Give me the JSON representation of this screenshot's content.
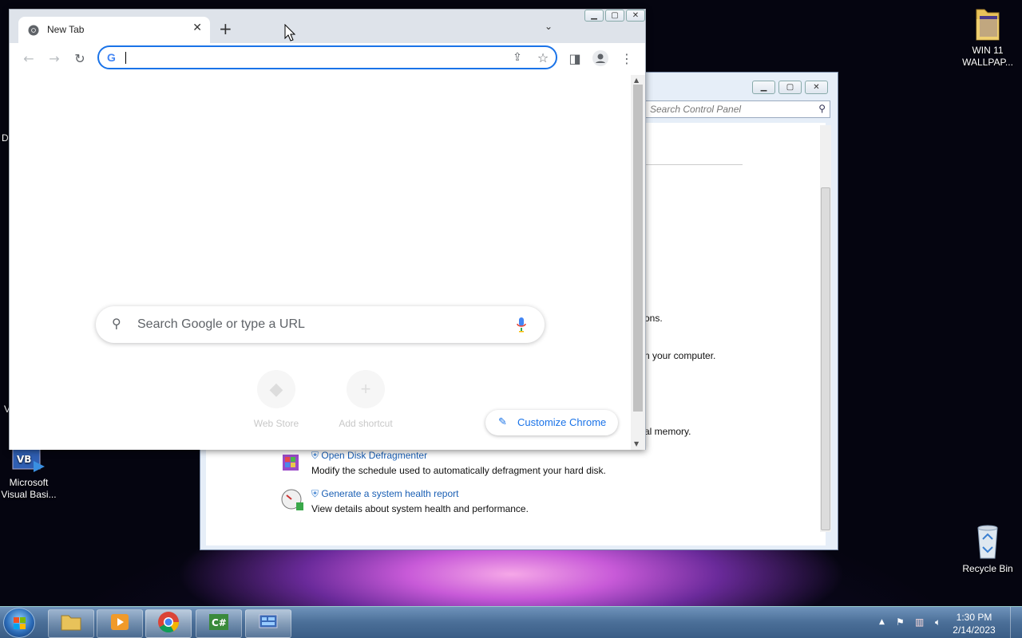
{
  "desktop": {
    "icons": [
      {
        "label": "WIN 11 WALLPAP..."
      },
      {
        "label": "Microsoft Visual Basi..."
      },
      {
        "label": "Recycle Bin"
      }
    ],
    "edge_fragments": [
      "D",
      "V"
    ]
  },
  "control_panel": {
    "search_placeholder": "Search Control Panel",
    "fragments": [
      "ons.",
      "n your computer.",
      "al memory."
    ],
    "items": [
      {
        "link": "Open Disk Defragmenter",
        "desc": "Modify the schedule used to automatically defragment your hard disk."
      },
      {
        "link": "Generate a system health report",
        "desc": "View details about system health and performance."
      }
    ]
  },
  "chrome": {
    "tab_title": "New Tab",
    "omnibox_value": "",
    "search_placeholder": "Search Google or type a URL",
    "shortcuts": [
      {
        "label": "Web Store"
      },
      {
        "label": "Add shortcut"
      }
    ],
    "customize_label": "Customize Chrome"
  },
  "taskbar": {
    "apps": [
      "windows-explorer",
      "media-player",
      "chrome",
      "csharp-ide",
      "control-panel"
    ],
    "clock_time": "1:30 PM",
    "clock_date": "2/14/2023"
  }
}
